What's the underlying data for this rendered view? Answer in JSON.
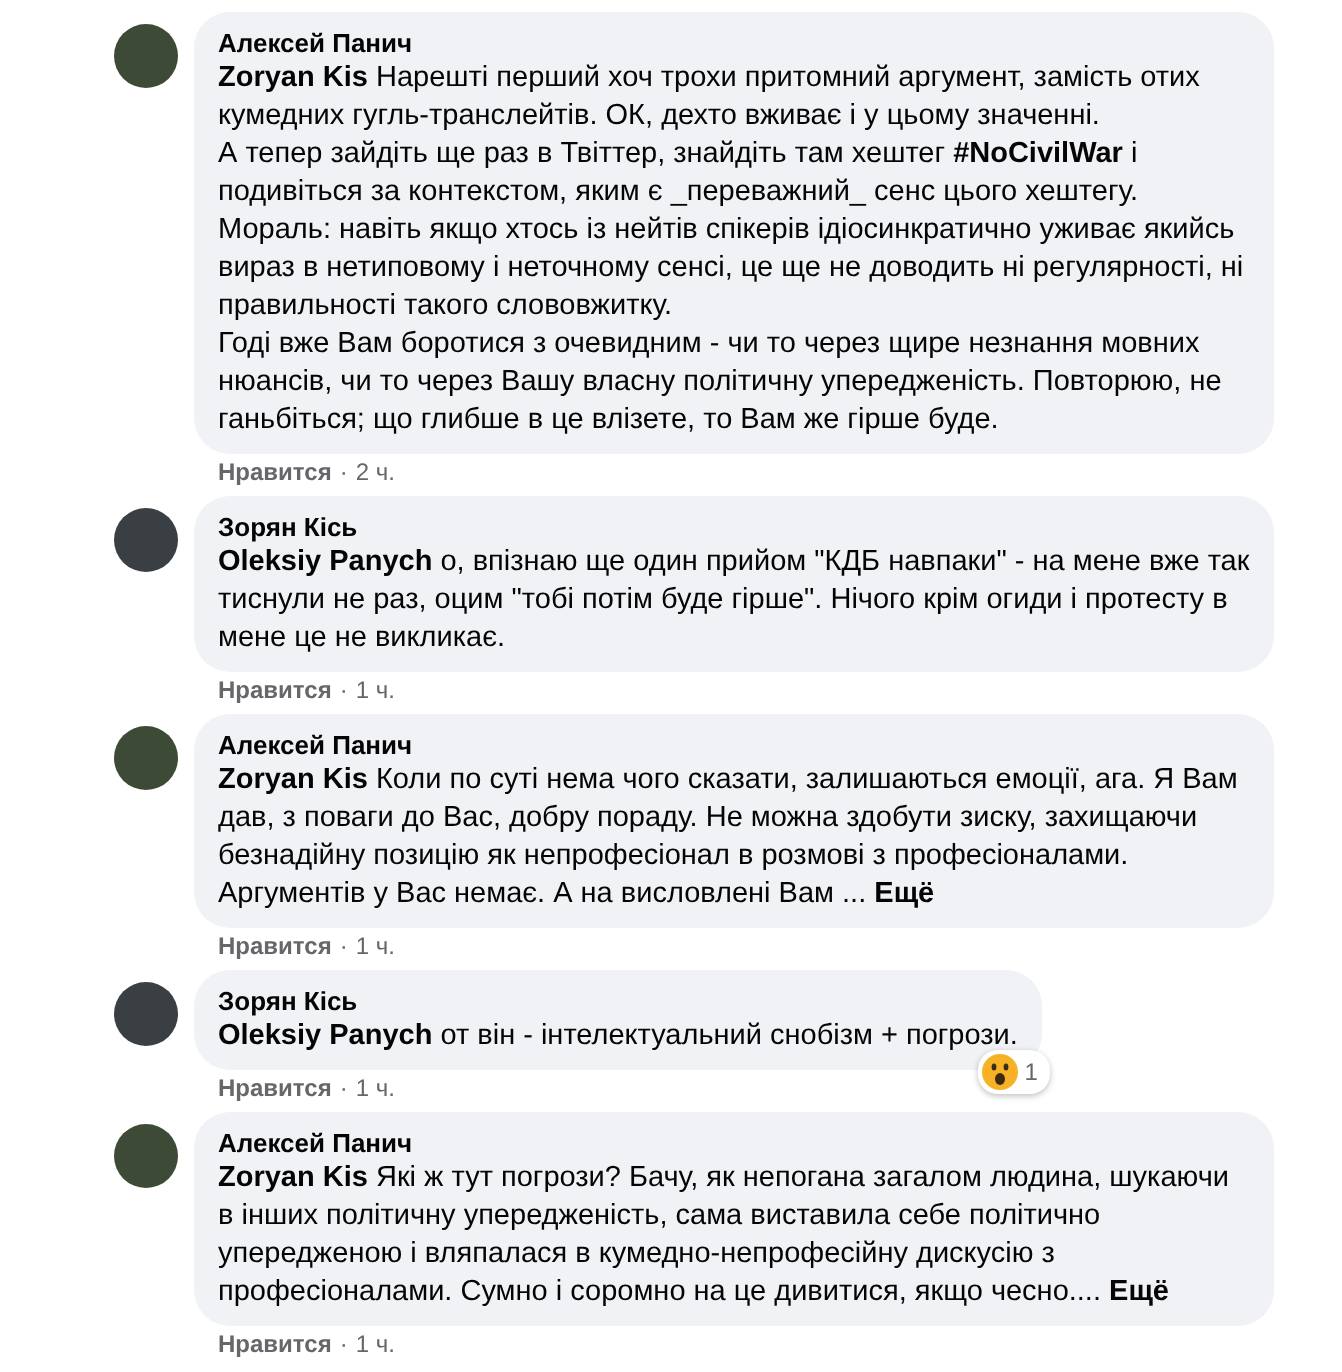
{
  "comments": [
    {
      "author": "Алексей Панич",
      "text": "**Zoryan Kis** Нарешті перший хоч трохи притомний аргумент, замість отих кумедних гугль-транслейтів. ОК, дехто вживає і у цьому значенні.\nА тепер зайдіть ще раз в Твіттер, знайдіть там хештег **#NoCivilWar** і подивіться за контекстом, яким є _переважний_ сенс цього хештегу.\nМораль: навіть якщо хтось із нейтів спікерів ідіосинкратично уживає якийсь вираз в нетиповому і неточному сенсі, це ще не доводить ні регулярності, ні правильності такого слововжитку.\nГоді вже Вам боротися з очевидним - чи то через щире незнання мовних нюансів, чи то через Вашу власну політичну упередженість. Повторюю, не ганьбіться; що глибше в це влізете, то Вам же гірше буде.",
      "like": "Нравится",
      "separator": "·",
      "time": "2 ч."
    },
    {
      "author": "Зорян Кісь",
      "text": "**Oleksiy Panych** о, впізнаю ще один прийом \"КДБ навпаки\" - на мене вже так тиснули не раз, оцим \"тобі потім буде гірше\". Нічого крім огиди і протесту в мене це не викликає.",
      "like": "Нравится",
      "separator": "·",
      "time": "1 ч."
    },
    {
      "author": "Алексей Панич",
      "text": "**Zoryan Kis** Коли по суті нема чого сказати, залишаються емоції, ага. Я Вам дав, з поваги до Вас, добру пораду. Не можна здобути зиску, захищаючи безнадійну позицію як непрофесіонал в розмові з професіоналами. Аргументів у Вас немає. А на висловлені Вам ...",
      "more": "Ещё",
      "like": "Нравится",
      "separator": "·",
      "time": "1 ч."
    },
    {
      "author": "Зорян Кісь",
      "text": "**Oleksiy Panych** от він - інтелектуальний снобізм + погрози.",
      "like": "Нравится",
      "separator": "·",
      "time": "1 ч.",
      "reaction_count": "1"
    },
    {
      "author": "Алексей Панич",
      "text": "**Zoryan Kis** Які ж тут погрози? Бачу, як непогана загалом людина, шукаючи в інших політичну упередженість, сама виставила себе політично упередженою і вляпалася в кумедно-непрофесійну дискусію з професіоналами. Сумно і соромно на це дивитися, якщо чесно....",
      "more": "Ещё",
      "like": "Нравится",
      "separator": "·",
      "time": "1 ч."
    }
  ]
}
